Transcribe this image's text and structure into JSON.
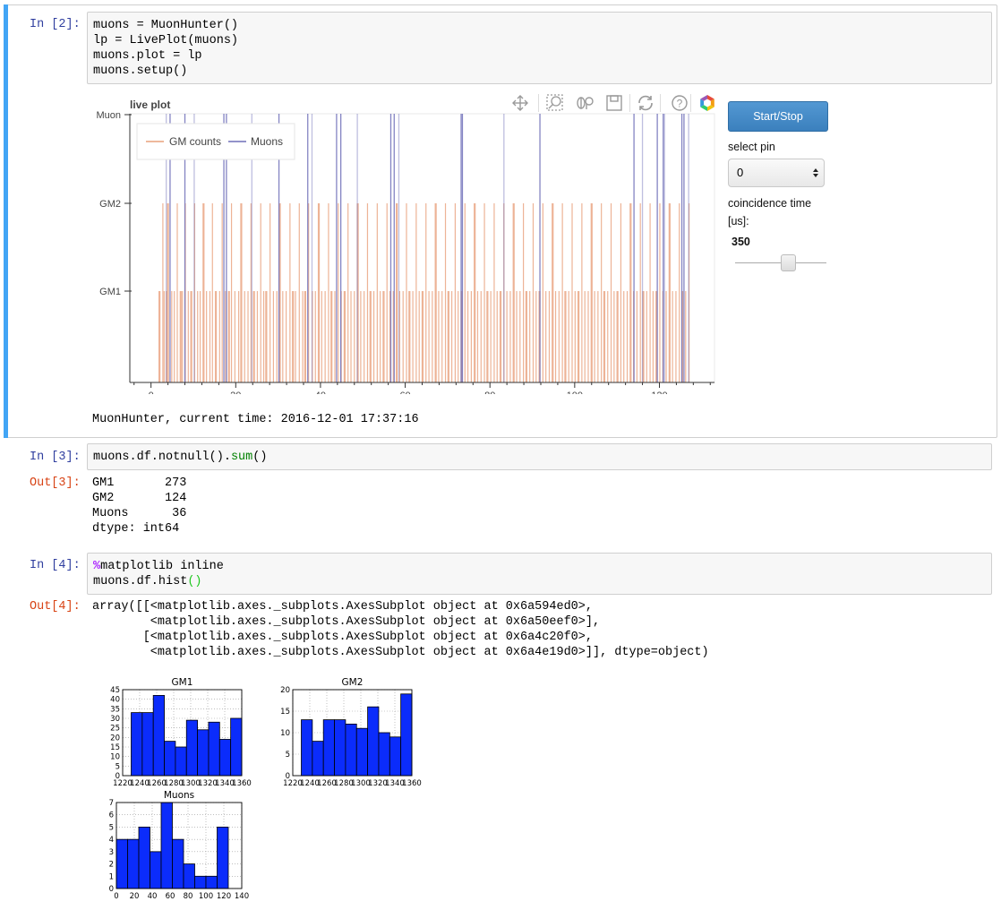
{
  "cells": {
    "c2": {
      "prompt": "In [2]:",
      "lines": [
        "muons = MuonHunter()",
        "lp = LivePlot(muons)",
        "muons.plot = lp",
        "muons.setup()"
      ],
      "output_text": "MuonHunter, current time: 2016-12-01 17:37:16"
    },
    "c3": {
      "prompt": "In [3]:",
      "code_a": "muons.df.notnull().",
      "code_b": "sum",
      "code_c": "()",
      "out_prompt": "Out[3]:",
      "out_lines": [
        "GM1       273",
        "GM2       124",
        "Muons      36",
        "dtype: int64"
      ]
    },
    "c4": {
      "prompt": "In [4]:",
      "line1_magic": "%",
      "line1_rest": "matplotlib inline",
      "line2_a": "muons.df.hist",
      "line2_b": "()",
      "out_prompt": "Out[4]:",
      "out_lines": [
        "array([[<matplotlib.axes._subplots.AxesSubplot object at 0x6a594ed0>,",
        "        <matplotlib.axes._subplots.AxesSubplot object at 0x6a50eef0>],",
        "       [<matplotlib.axes._subplots.AxesSubplot object at 0x6a4c20f0>,",
        "        <matplotlib.axes._subplots.AxesSubplot object at 0x6a4e19d0>]], dtype=object)"
      ]
    }
  },
  "widget": {
    "start_stop_label": "Start/Stop",
    "select_pin_label": "select pin",
    "pin_value": "0",
    "coincidence_label_1": "coincidence time",
    "coincidence_label_2": "[us]:",
    "slider_value": "350",
    "slider_fraction": 0.58
  },
  "toolbar_icons": [
    "pan-icon",
    "box-zoom-icon",
    "wheel-zoom-icon",
    "save-icon",
    "reset-icon",
    "help-icon",
    "bokeh-logo-icon"
  ],
  "colors": {
    "gm": "#e8a07c",
    "muon": "#6f6fb8",
    "bar_fill": "#0b2cfb",
    "cell_bar": "#42a5f5",
    "button": "#428bca"
  },
  "chart_data": [
    {
      "type": "line",
      "title": "live plot",
      "y_categories": [
        "Muon",
        "GM2",
        "GM1"
      ],
      "x_ticks": [
        0,
        20,
        40,
        60,
        80,
        100,
        120
      ],
      "xlim": [
        -5,
        133
      ],
      "legend": [
        "GM counts",
        "Muons"
      ],
      "legend_position": "top-left",
      "series": [
        {
          "name": "GM counts",
          "values": [
            2,
            2.8,
            3.1,
            3.6,
            4.0,
            4.9,
            5.5,
            6.2,
            7.0,
            7.4,
            8.1,
            8.8,
            9.5,
            10.3,
            11.0,
            11.6,
            12.4,
            13.1,
            13.9,
            14.5,
            15.3,
            16.2,
            16.8,
            17.6,
            18.4,
            19.0,
            19.8,
            20.7,
            21.3,
            22.1,
            22.9,
            23.6,
            24.3,
            25.1,
            25.9,
            26.6,
            27.2,
            28.1,
            28.9,
            29.7,
            30.4,
            31.1,
            31.9,
            32.8,
            33.5,
            34.1,
            35.0,
            35.8,
            36.4,
            37.2,
            38.1,
            38.8,
            39.6,
            40.3,
            41.1,
            41.9,
            42.6,
            43.4,
            44.2,
            44.9,
            45.7,
            46.5,
            47.2,
            48.0,
            48.8,
            49.5,
            50.3,
            51.1,
            51.8,
            52.6,
            53.4,
            54.1,
            54.9,
            55.7,
            56.4,
            57.2,
            58.0,
            58.7,
            59.5,
            60.3,
            61.0,
            61.8,
            62.6,
            63.3,
            64.1,
            64.9,
            65.6,
            66.4,
            67.2,
            67.9,
            68.7,
            69.5,
            70.2,
            71.0,
            71.8,
            72.5,
            73.3,
            74.1,
            74.8,
            75.6,
            76.4,
            77.1,
            77.9,
            78.7,
            79.4,
            80.2,
            81.0,
            81.7,
            82.5,
            83.3,
            84.0,
            84.8,
            85.6,
            86.3,
            87.1,
            87.9,
            88.6,
            89.4,
            90.2,
            90.9,
            91.7,
            92.5,
            93.2,
            94.0,
            94.8,
            95.5,
            96.3,
            97.1,
            97.8,
            98.6,
            99.4,
            100.1,
            100.9,
            101.7,
            102.4,
            103.2,
            104.0,
            104.7,
            105.5,
            106.3,
            107.0,
            107.8,
            108.6,
            109.3,
            110.1,
            110.9,
            111.6,
            112.4,
            113.2,
            113.9,
            114.7,
            115.5,
            116.2,
            117.0,
            117.8,
            118.5,
            119.3,
            120.1,
            120.8,
            121.6,
            122.4,
            123.1,
            123.9,
            124.7,
            125.4,
            126.2,
            127.0
          ]
        },
        {
          "name": "Muons",
          "values": [
            3.6,
            4.5,
            8.0,
            10.2,
            17.2,
            17.8,
            23.8,
            30.2,
            37.0,
            38.0,
            43.8,
            44.8,
            48.7,
            56.6,
            57.4,
            58.5,
            73.2,
            73.5,
            83.3,
            91.8,
            114.0,
            116.0,
            119.5,
            120.9,
            121.2,
            125.3,
            125.8,
            126.9
          ]
        }
      ]
    },
    {
      "type": "bar",
      "title": "GM1",
      "categories": [
        "1230",
        "1243",
        "1256",
        "1269",
        "1282",
        "1295",
        "1308",
        "1321",
        "1334",
        "1347"
      ],
      "values": [
        33,
        33,
        42,
        18,
        15,
        29,
        24,
        28,
        19,
        30
      ],
      "xlim": [
        1220,
        1360
      ],
      "ylim": [
        0,
        45
      ],
      "x_ticks": [
        1220,
        1240,
        1260,
        1280,
        1300,
        1320,
        1340,
        1360
      ],
      "y_ticks": [
        0,
        5,
        10,
        15,
        20,
        25,
        30,
        35,
        40,
        45
      ]
    },
    {
      "type": "bar",
      "title": "GM2",
      "categories": [
        "1230",
        "1243",
        "1256",
        "1269",
        "1282",
        "1295",
        "1308",
        "1321",
        "1334",
        "1347"
      ],
      "values": [
        13,
        8,
        13,
        13,
        12,
        11,
        16,
        10,
        9,
        19
      ],
      "xlim": [
        1220,
        1360
      ],
      "ylim": [
        0,
        20
      ],
      "x_ticks": [
        1220,
        1240,
        1260,
        1280,
        1300,
        1320,
        1340,
        1360
      ],
      "y_ticks": [
        0,
        5,
        10,
        15,
        20
      ]
    },
    {
      "type": "bar",
      "title": "Muons",
      "categories": [
        "6",
        "19",
        "31",
        "44",
        "56",
        "69",
        "81",
        "94",
        "106",
        "119"
      ],
      "values": [
        4,
        4,
        5,
        3,
        7,
        4,
        2,
        1,
        1,
        5
      ],
      "xlim": [
        0,
        140
      ],
      "ylim": [
        0,
        7
      ],
      "x_ticks": [
        0,
        20,
        40,
        60,
        80,
        100,
        120,
        140
      ],
      "y_ticks": [
        0,
        1,
        2,
        3,
        4,
        5,
        6,
        7
      ]
    }
  ]
}
